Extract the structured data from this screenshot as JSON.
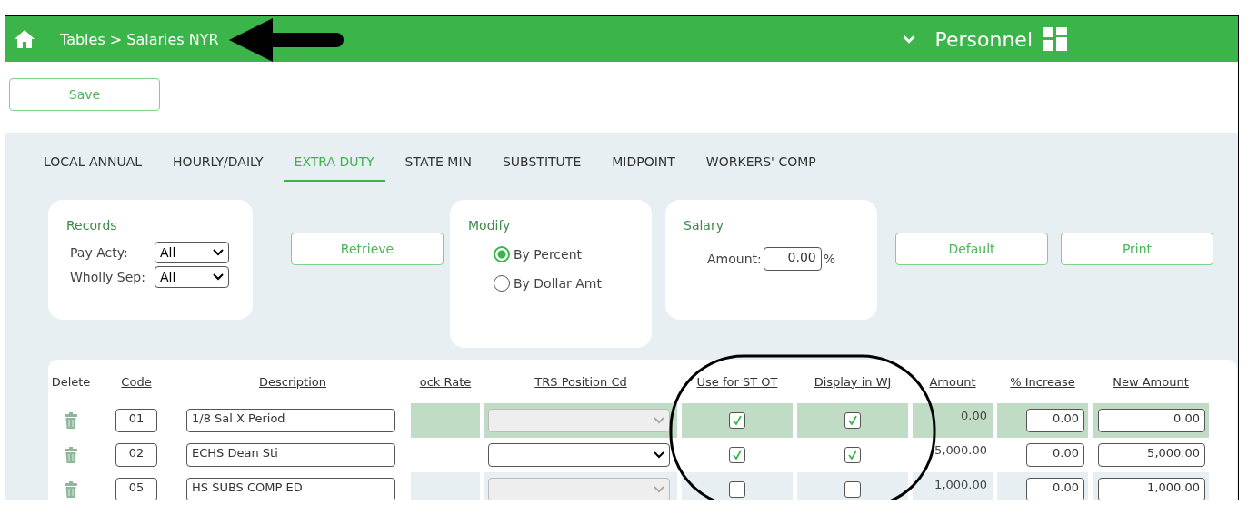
{
  "header": {
    "breadcrumb": "Tables > Salaries NYR",
    "app_title": "Personnel"
  },
  "toolbar": {
    "buttons": [
      "Save"
    ]
  },
  "tabs": [
    {
      "label": "LOCAL ANNUAL",
      "selected": false
    },
    {
      "label": "HOURLY/DAILY",
      "selected": false
    },
    {
      "label": "EXTRA DUTY",
      "selected": true
    },
    {
      "label": "STATE MIN",
      "selected": false
    },
    {
      "label": "SUBSTITUTE",
      "selected": false
    },
    {
      "label": "MIDPOINT",
      "selected": false
    },
    {
      "label": "WORKERS' COMP",
      "selected": false
    }
  ],
  "records": {
    "title": "Records",
    "filters": [
      {
        "label": "Pay Acty:",
        "value": "All"
      },
      {
        "label": "Wholly Sep:",
        "value": "All"
      }
    ]
  },
  "retrieve_button": "Retrieve",
  "modify": {
    "title": "Modify",
    "options": [
      {
        "label": "By Percent",
        "selected": true
      },
      {
        "label": "By Dollar Amt",
        "selected": false
      }
    ]
  },
  "salary": {
    "title": "Salary",
    "amount_label": "Amount:",
    "amount": "0.00",
    "unit": "%"
  },
  "action_buttons": [
    "Default",
    "Print"
  ],
  "table": {
    "columns": [
      "Delete",
      "Code",
      "Description",
      "ock Rate",
      "TRS Position Cd",
      "Use for ST OT",
      "Display in WJ",
      "Amount",
      "% Increase",
      "New Amount"
    ],
    "rows": [
      {
        "selected": true,
        "code": "01",
        "description": "1/8 Sal X Period",
        "trs_disabled": true,
        "use_st_ot": true,
        "display_wj": true,
        "amount": "0.00",
        "increase": "0.00",
        "new_amount": "0.00"
      },
      {
        "selected": false,
        "code": "02",
        "description": "ECHS Dean Sti",
        "trs_disabled": false,
        "use_st_ot": true,
        "display_wj": true,
        "amount": "5,000.00",
        "increase": "0.00",
        "new_amount": "5,000.00"
      },
      {
        "selected": false,
        "code": "05",
        "description": "HS SUBS COMP ED",
        "trs_disabled": true,
        "use_st_ot": false,
        "display_wj": false,
        "amount": "1,000.00",
        "increase": "0.00",
        "new_amount": "1,000.00"
      }
    ]
  }
}
